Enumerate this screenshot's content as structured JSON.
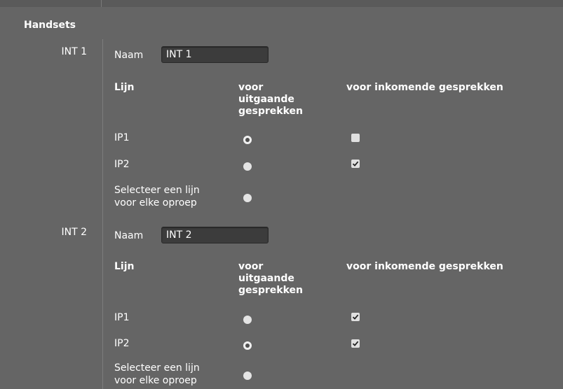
{
  "section": {
    "title": "Handsets"
  },
  "columns": {
    "line": "Lijn",
    "outgoing_1": "voor",
    "outgoing_2": "uitgaande",
    "outgoing_3": "gesprekken",
    "incoming": "voor inkomende gesprekken"
  },
  "handsets": [
    {
      "label": "INT 1",
      "name_label": "Naam",
      "name_value": "INT 1",
      "rows": [
        {
          "label": "IP1",
          "outgoing_selected": true,
          "incoming_checked": false
        },
        {
          "label": "IP2",
          "outgoing_selected": false,
          "incoming_checked": true
        },
        {
          "label_1": "Selecteer een lijn",
          "label_2": "voor elke oproep",
          "outgoing_selected": false
        }
      ]
    },
    {
      "label": "INT 2",
      "name_label": "Naam",
      "name_value": "INT 2",
      "rows": [
        {
          "label": "IP1",
          "outgoing_selected": false,
          "incoming_checked": true
        },
        {
          "label": "IP2",
          "outgoing_selected": true,
          "incoming_checked": true
        },
        {
          "label_1": "Selecteer een lijn",
          "label_2": "voor elke oproep",
          "outgoing_selected": false
        }
      ]
    }
  ]
}
